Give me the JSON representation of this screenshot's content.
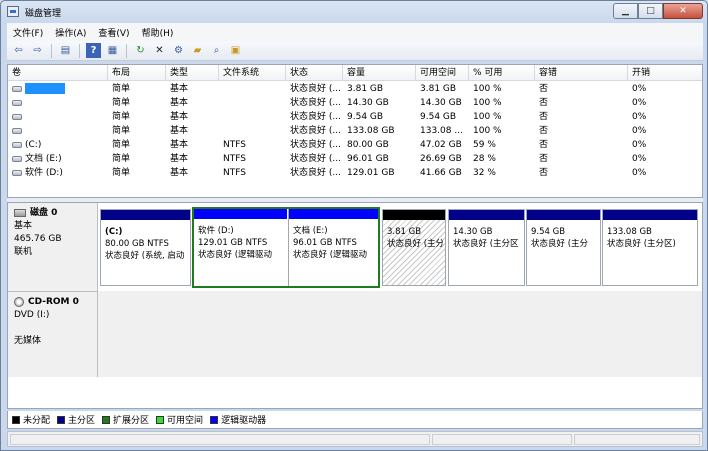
{
  "window": {
    "title": "磁盘管理"
  },
  "menu": [
    "文件(F)",
    "操作(A)",
    "查看(V)",
    "帮助(H)"
  ],
  "toolbar_icons": [
    "back-icon",
    "forward-icon",
    "properties-icon",
    "help-icon",
    "refresh-icon",
    "delete-icon",
    "settings-icon",
    "open-icon",
    "search-icon",
    "export-icon"
  ],
  "volumes": {
    "columns": [
      "卷",
      "布局",
      "类型",
      "文件系统",
      "状态",
      "容量",
      "可用空间",
      "% 可用",
      "容错",
      "开销"
    ],
    "rows": [
      {
        "name": "",
        "layout": "简单",
        "type": "基本",
        "fs": "",
        "status": "状态良好 (...",
        "capacity": "3.81 GB",
        "free": "3.81 GB",
        "pct": "100 %",
        "ft": "否",
        "overhead": "0%"
      },
      {
        "name": "",
        "layout": "简单",
        "type": "基本",
        "fs": "",
        "status": "状态良好 (...",
        "capacity": "14.30 GB",
        "free": "14.30 GB",
        "pct": "100 %",
        "ft": "否",
        "overhead": "0%"
      },
      {
        "name": "",
        "layout": "简单",
        "type": "基本",
        "fs": "",
        "status": "状态良好 (...",
        "capacity": "9.54 GB",
        "free": "9.54 GB",
        "pct": "100 %",
        "ft": "否",
        "overhead": "0%"
      },
      {
        "name": "",
        "layout": "简单",
        "type": "基本",
        "fs": "",
        "status": "状态良好 (...",
        "capacity": "133.08 GB",
        "free": "133.08 ...",
        "pct": "100 %",
        "ft": "否",
        "overhead": "0%"
      },
      {
        "name": "(C:)",
        "layout": "简单",
        "type": "基本",
        "fs": "NTFS",
        "status": "状态良好 (...",
        "capacity": "80.00 GB",
        "free": "47.02 GB",
        "pct": "59 %",
        "ft": "否",
        "overhead": "0%"
      },
      {
        "name": "文档 (E:)",
        "layout": "简单",
        "type": "基本",
        "fs": "NTFS",
        "status": "状态良好 (...",
        "capacity": "96.01 GB",
        "free": "26.69 GB",
        "pct": "28 %",
        "ft": "否",
        "overhead": "0%"
      },
      {
        "name": "软件 (D:)",
        "layout": "简单",
        "type": "基本",
        "fs": "NTFS",
        "status": "状态良好 (...",
        "capacity": "129.01 GB",
        "free": "41.66 GB",
        "pct": "32 %",
        "ft": "否",
        "overhead": "0%"
      }
    ]
  },
  "disk0": {
    "name": "磁盘 0",
    "type": "基本",
    "size": "465.76 GB",
    "state": "联机",
    "partitions": [
      {
        "label": "(C:)",
        "size": "80.00 GB NTFS",
        "status": "状态良好 (系统, 启动"
      },
      {
        "label": "软件 (D:)",
        "size": "129.01 GB NTFS",
        "status": "状态良好 (逻辑驱动"
      },
      {
        "label": "文档 (E:)",
        "size": "96.01 GB NTFS",
        "status": "状态良好 (逻辑驱动"
      },
      {
        "label": "",
        "size": "3.81 GB",
        "status": "状态良好 (主分"
      },
      {
        "label": "",
        "size": "14.30 GB",
        "status": "状态良好 (主分区"
      },
      {
        "label": "",
        "size": "9.54 GB",
        "status": "状态良好 (主分"
      },
      {
        "label": "",
        "size": "133.08 GB",
        "status": "状态良好 (主分区)"
      }
    ]
  },
  "cdrom0": {
    "name": "CD-ROM 0",
    "type": "DVD (I:)",
    "media": "无媒体"
  },
  "legend": [
    {
      "label": "未分配",
      "color": "#000000"
    },
    {
      "label": "主分区",
      "color": "#000088"
    },
    {
      "label": "扩展分区",
      "color": "#1e7b1e"
    },
    {
      "label": "可用空间",
      "color": "#33dd33"
    },
    {
      "label": "逻辑驱动器",
      "color": "#0000ff"
    }
  ]
}
